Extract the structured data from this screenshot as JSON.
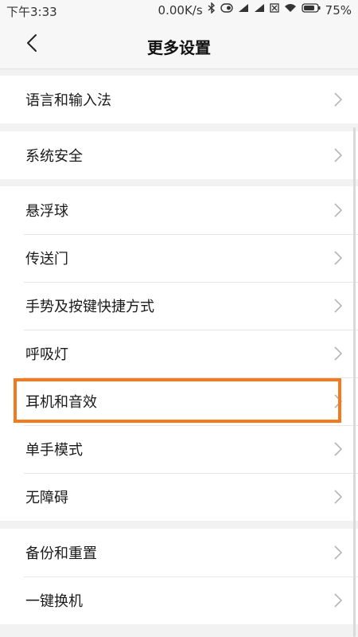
{
  "status_bar": {
    "time": "下午3:33",
    "net_speed": "0.00K/s",
    "battery": "75%"
  },
  "header": {
    "title": "更多设置"
  },
  "groups": [
    {
      "items": [
        {
          "label": "语言和输入法"
        }
      ]
    },
    {
      "items": [
        {
          "label": "系统安全"
        }
      ]
    },
    {
      "items": [
        {
          "label": "悬浮球"
        },
        {
          "label": "传送门"
        },
        {
          "label": "手势及按键快捷方式"
        },
        {
          "label": "呼吸灯"
        },
        {
          "label": "耳机和音效"
        },
        {
          "label": "单手模式"
        },
        {
          "label": "无障碍"
        }
      ]
    },
    {
      "items": [
        {
          "label": "备份和重置"
        },
        {
          "label": "一键换机"
        }
      ]
    }
  ],
  "highlight_color": "#f47a20",
  "icons": [
    "back-arrow-icon",
    "chevron-right-icon",
    "bluetooth-icon",
    "signal-icon",
    "wifi-icon",
    "battery-icon"
  ]
}
